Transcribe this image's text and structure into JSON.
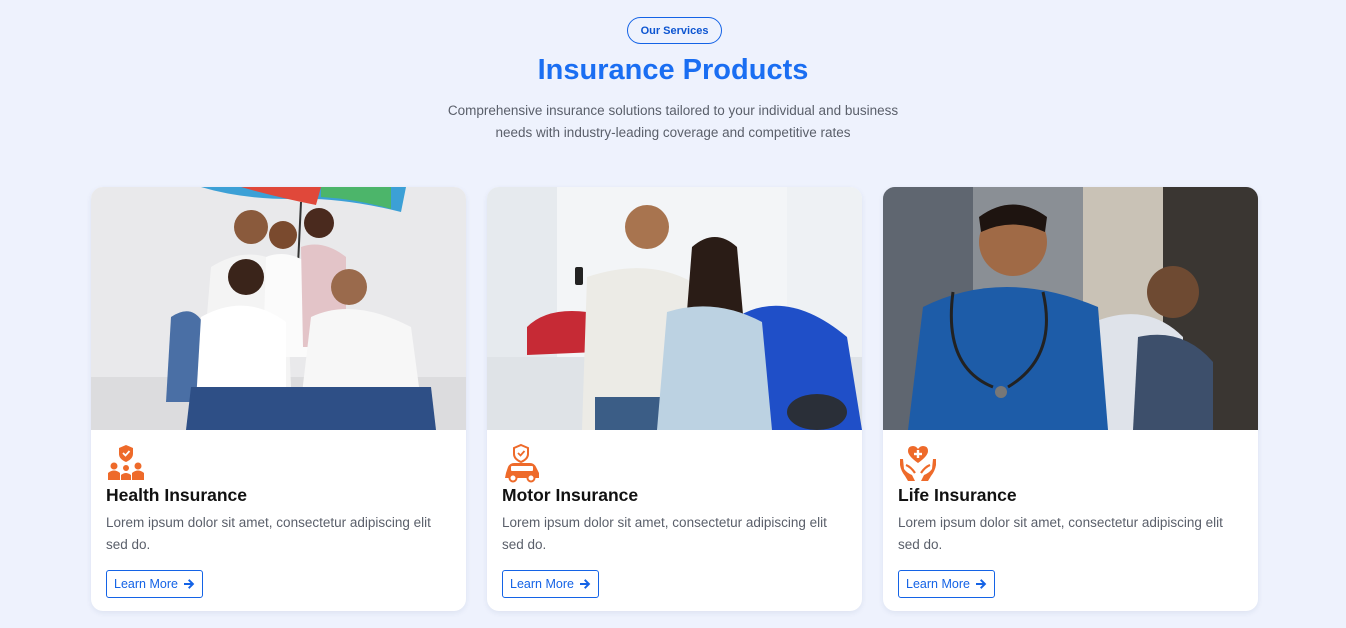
{
  "header": {
    "badge": "Our Services",
    "title": "Insurance Products",
    "subtitle_line1": "Comprehensive insurance solutions tailored to your individual and business",
    "subtitle_line2": "needs with industry-leading coverage and competitive rates"
  },
  "colors": {
    "accent_blue": "#1463e6",
    "title_blue": "#1a6ef2",
    "icon_orange": "#ee6a2a",
    "background": "#eef2fd"
  },
  "cards": [
    {
      "title": "Health Insurance",
      "description": "Lorem ipsum dolor sit amet, consectetur adipiscing elit sed do.",
      "button_label": "Learn More",
      "icon": "family-shield-icon",
      "image": "family-under-umbrella-photo"
    },
    {
      "title": "Motor Insurance",
      "description": "Lorem ipsum dolor sit amet, consectetur adipiscing elit sed do.",
      "button_label": "Learn More",
      "icon": "car-shield-icon",
      "image": "couple-with-car-keys-photo"
    },
    {
      "title": "Life Insurance",
      "description": "Lorem ipsum dolor sit amet, consectetur adipiscing elit sed do.",
      "button_label": "Learn More",
      "icon": "hands-heart-icon",
      "image": "doctor-with-patient-photo"
    }
  ]
}
